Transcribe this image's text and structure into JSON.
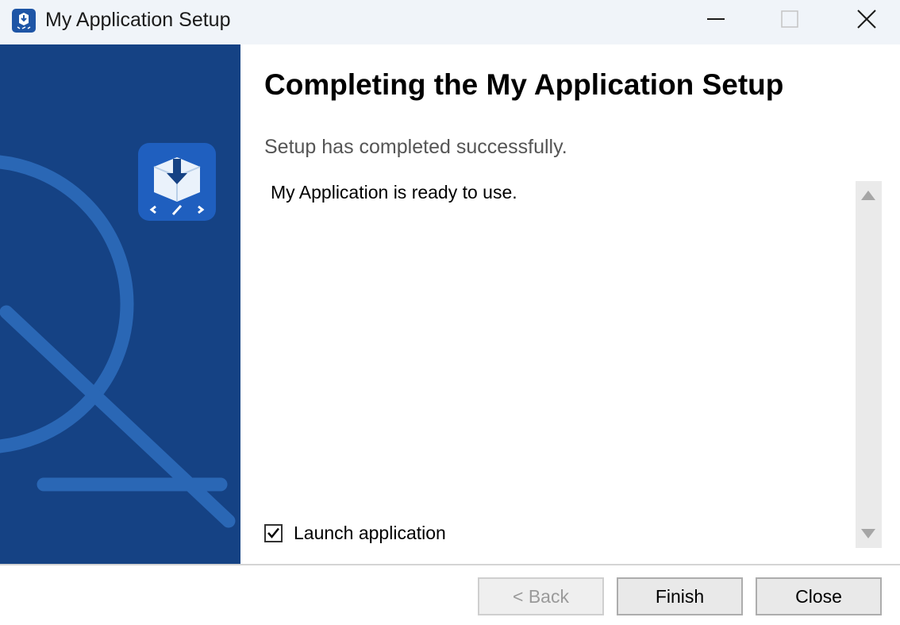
{
  "window": {
    "title": "My Application Setup",
    "icons": {
      "app": "installer-icon",
      "minimize": "minimize-icon",
      "maximize": "maximize-icon",
      "close": "close-icon"
    }
  },
  "banner": {
    "background_color": "#154284",
    "decoration_color": "#2a67b5",
    "icon": "installer-box-icon"
  },
  "content": {
    "heading": "Completing the My Application Setup",
    "subheading": "Setup has completed successfully.",
    "message": "My Application is ready to use.",
    "launch_checkbox": {
      "label": "Launch application",
      "checked": true
    }
  },
  "footer": {
    "back_label": "< Back",
    "back_enabled": false,
    "finish_label": "Finish",
    "close_label": "Close"
  }
}
